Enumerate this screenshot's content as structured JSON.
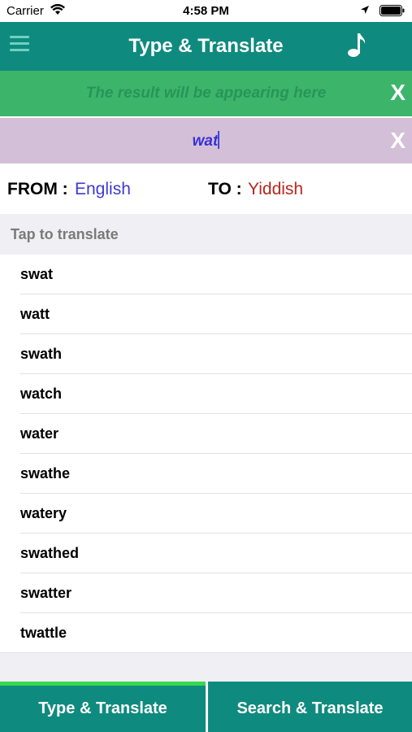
{
  "status": {
    "carrier": "Carrier",
    "time": "4:58 PM"
  },
  "header": {
    "title": "Type & Translate",
    "menu_icon": "hamburger-icon",
    "music_icon": "music-note-icon"
  },
  "result": {
    "placeholder": "The result will be appearing here",
    "clear_label": "X"
  },
  "input": {
    "value": "wat",
    "clear_label": "X"
  },
  "languages": {
    "from_label": "FROM :",
    "from_value": "English",
    "to_label": "TO :",
    "to_value": "Yiddish"
  },
  "list": {
    "header": "Tap to translate",
    "items": [
      "swat",
      "watt",
      "swath",
      "watch",
      "water",
      "swathe",
      "watery",
      "swathed",
      "swatter",
      "twattle"
    ]
  },
  "tabs": {
    "type_label": "Type & Translate",
    "search_label": "Search & Translate",
    "active": "Type & Translate"
  },
  "colors": {
    "primary": "#0f8a7e",
    "result_bg": "#3cb56a",
    "input_bg": "#d4bfd8",
    "from_color": "#3d3ad0",
    "to_color": "#b4281e",
    "active_indicator": "#37d84d"
  }
}
